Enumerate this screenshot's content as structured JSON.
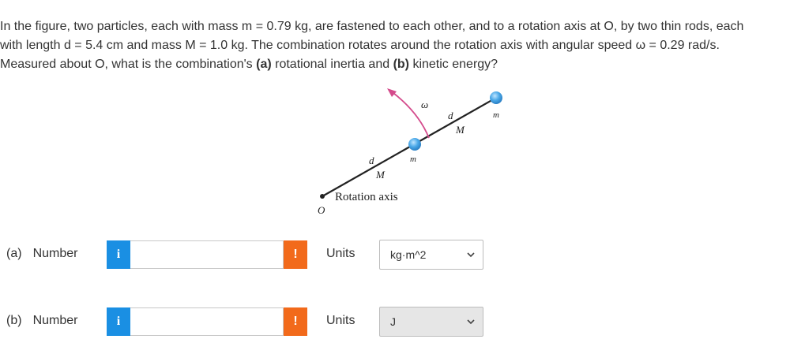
{
  "question": {
    "line1": "In the figure, two particles, each with mass m = 0.79 kg, are fastened to each other, and to a rotation axis at O, by two thin rods, each",
    "line2": "with length d = 5.4 cm and mass M = 1.0 kg. The combination rotates around the rotation axis with angular speed ω = 0.29 rad/s.",
    "line3_prefix": "Measured about O, what is the combination's ",
    "line3_a": "(a)",
    "line3_mid": " rotational inertia and ",
    "line3_b": "(b)",
    "line3_suffix": " kinetic energy?"
  },
  "figure": {
    "omega": "ω",
    "d_upper": "d",
    "M_upper": "M",
    "m_upper": "m",
    "m_middle": "m",
    "d_lower": "d",
    "M_lower": "M",
    "rotation_axis": "Rotation axis",
    "origin": "O",
    "colors": {
      "particle": "#4aa8e8",
      "arrow": "#d44b8c",
      "rod": "#222222"
    }
  },
  "answers": {
    "a": {
      "part": "(a)",
      "number_label": "Number",
      "info": "i",
      "value": "",
      "warn": "!",
      "units_label": "Units",
      "units_value": "kg·m^2"
    },
    "b": {
      "part": "(b)",
      "number_label": "Number",
      "info": "i",
      "value": "",
      "warn": "!",
      "units_label": "Units",
      "units_value": "J"
    }
  }
}
